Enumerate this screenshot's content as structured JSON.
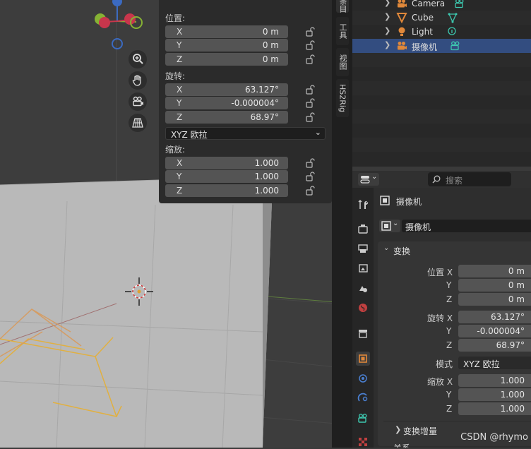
{
  "npanel": {
    "location_label": "位置:",
    "rotation_label": "旋转:",
    "scale_label": "缩放:",
    "location": [
      {
        "axis": "X",
        "value": "0 m"
      },
      {
        "axis": "Y",
        "value": "0 m"
      },
      {
        "axis": "Z",
        "value": "0 m"
      }
    ],
    "rotation": [
      {
        "axis": "X",
        "value": "63.127°"
      },
      {
        "axis": "Y",
        "value": "-0.000004°"
      },
      {
        "axis": "Z",
        "value": "68.97°"
      }
    ],
    "rotation_mode": "XYZ 欧拉",
    "scale": [
      {
        "axis": "X",
        "value": "1.000"
      },
      {
        "axis": "Y",
        "value": "1.000"
      },
      {
        "axis": "Z",
        "value": "1.000"
      }
    ]
  },
  "sidebar_tabs": {
    "item": "条目",
    "tool": "工具",
    "view": "视图",
    "addon": "HS2Rig"
  },
  "outliner": {
    "rows": [
      {
        "name": "Camera",
        "icon": "camera-object-icon",
        "data_icon": "camera-data-icon"
      },
      {
        "name": "Cube",
        "icon": "mesh-object-icon",
        "data_icon": "mesh-data-icon"
      },
      {
        "name": "Light",
        "icon": "light-object-icon",
        "data_icon": "light-data-icon"
      },
      {
        "name": "摄像机",
        "icon": "camera-object-icon",
        "data_icon": "camera-data-icon",
        "selected": true
      }
    ]
  },
  "properties": {
    "search_placeholder": "搜索",
    "object_name_title": "摄像机",
    "object_name_field": "摄像机",
    "transform_panel": "变换",
    "location_label": "位置 X",
    "rotation_label": "旋转 X",
    "scale_label": "缩放 X",
    "axis_y": "Y",
    "axis_z": "Z",
    "mode_label": "模式",
    "location": [
      "0 m",
      "0 m",
      "0 m"
    ],
    "rotation": [
      "63.127°",
      "-0.000004°",
      "68.97°"
    ],
    "mode_value": "XYZ 欧拉",
    "scale": [
      "1.000",
      "1.000",
      "1.000"
    ],
    "delta_transform": "变换增量",
    "relations_partial": "关系"
  },
  "watermark": "CSDN @rhymo",
  "colors": {
    "accent": "#334d80",
    "orange": "#e0883a",
    "cyan": "#3dc9b0",
    "axis_x": "#c8364c",
    "axis_y": "#86b234",
    "axis_z": "#3b6ac0"
  }
}
